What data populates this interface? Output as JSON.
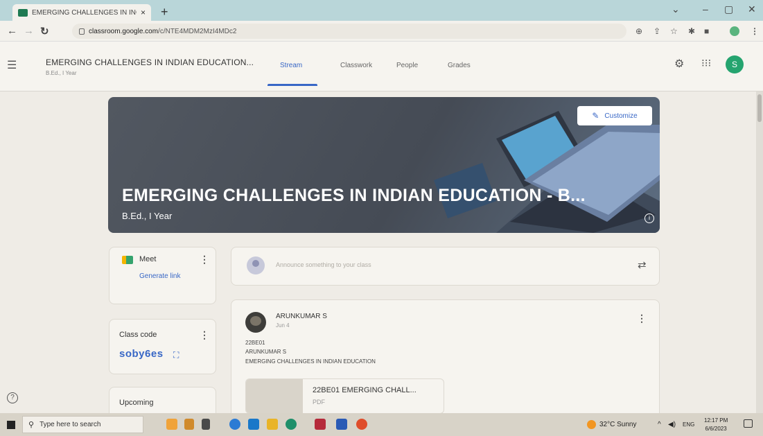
{
  "browser": {
    "tab_title": "EMERGING CHALLENGES IN INC",
    "tab_close": "×",
    "new_tab": "+",
    "url_host": "classroom.google.com",
    "url_path": "/c/NTE4MDM2MzI4MDc2",
    "window_controls": [
      "⌄",
      "–",
      "▢",
      "✕"
    ]
  },
  "classroom": {
    "title": "EMERGING CHALLENGES IN INDIAN EDUCATION...",
    "subtitle": "B.Ed., I Year",
    "tabs": [
      "Stream",
      "Classwork",
      "People",
      "Grades"
    ],
    "active_tab": "Stream",
    "avatar_letter": "S"
  },
  "banner": {
    "title": "EMERGING CHALLENGES IN INDIAN EDUCATION - B...",
    "subtitle": "B.Ed., I Year",
    "customize_label": "Customize",
    "info": "i"
  },
  "meet": {
    "label": "Meet",
    "generate_link": "Generate link"
  },
  "class_code": {
    "label": "Class code",
    "value": "soby6es"
  },
  "upcoming": {
    "label": "Upcoming"
  },
  "announce": {
    "placeholder": "Announce something to your class"
  },
  "post": {
    "author": "ARUNKUMAR S",
    "date": "Jun 4",
    "lines": [
      "22BE01",
      "ARUNKUMAR S",
      "EMERGING CHALLENGES IN INDIAN EDUCATION"
    ],
    "attachment_name": "22BE01 EMERGING CHALL...",
    "attachment_type": "PDF"
  },
  "taskbar": {
    "search_placeholder": "Type here to search",
    "weather": "32°C  Sunny",
    "lang": "ENG",
    "time": "12:17 PM",
    "date": "6/6/2023"
  },
  "colors": {
    "accent": "#3867c6",
    "avatar_bg": "#25a46f"
  }
}
